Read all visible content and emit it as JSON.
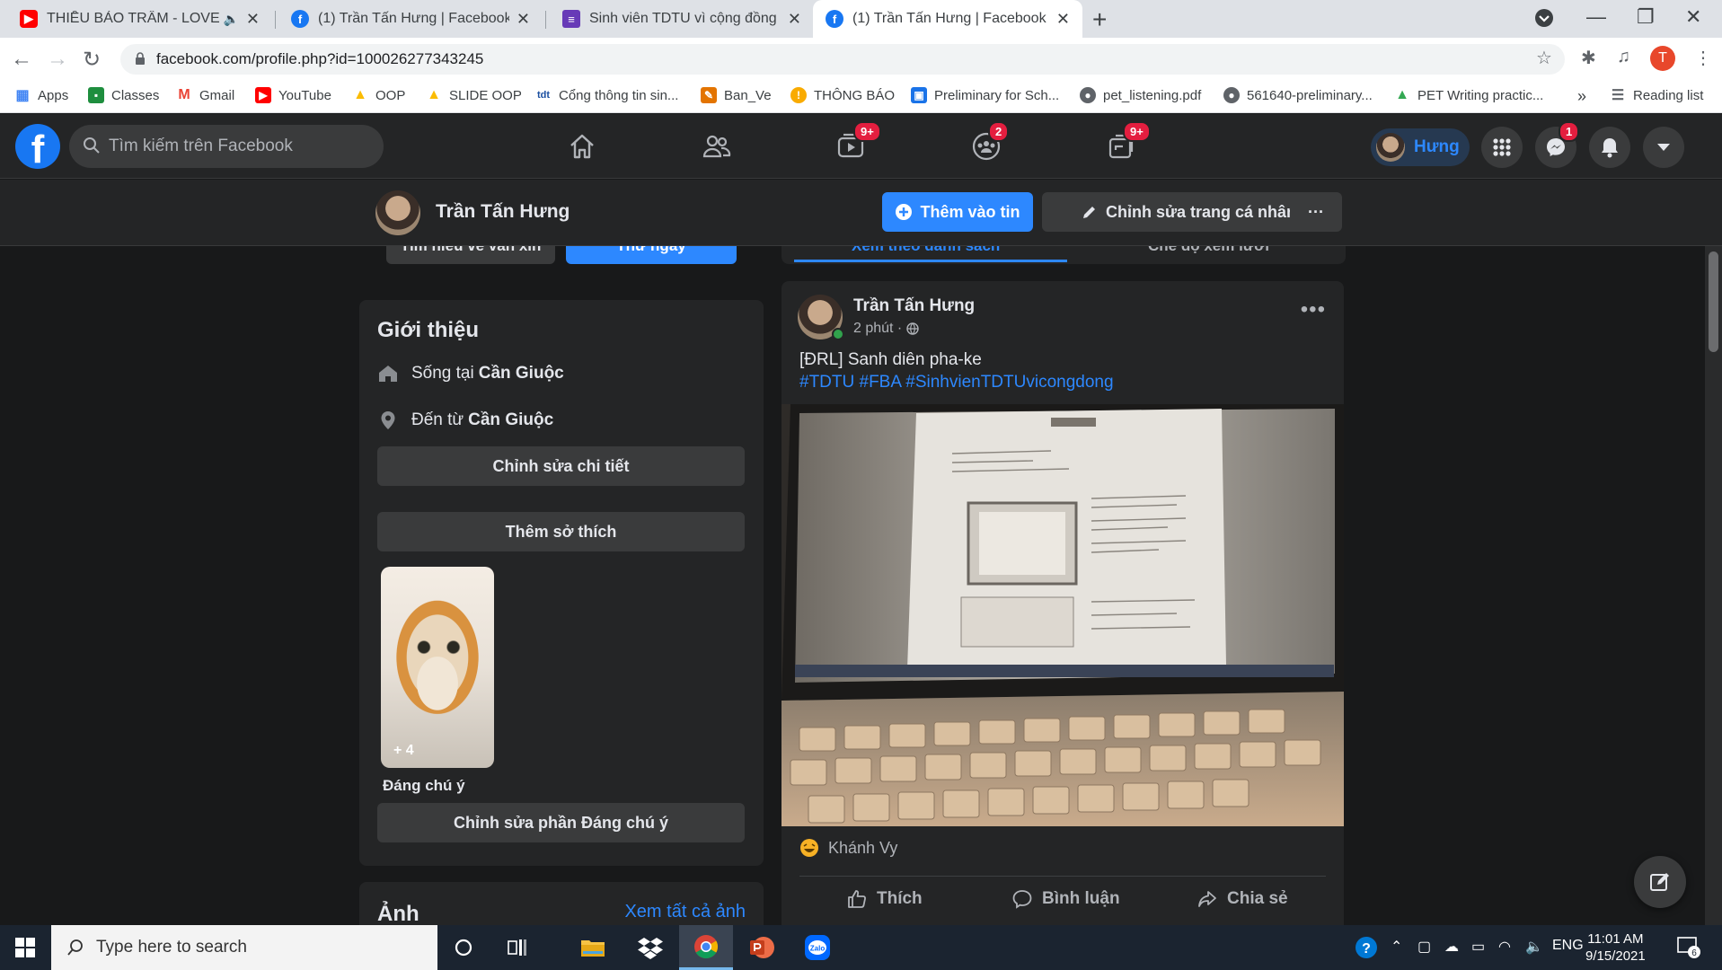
{
  "browser": {
    "tabs": [
      {
        "title": "THIỀU BẢO TRÂM - LOVE RO",
        "icon": "youtube-icon"
      },
      {
        "title": "(1) Trần Tấn Hưng | Facebook",
        "icon": "facebook-icon"
      },
      {
        "title": "Sinh viên TDTU vì cộng đồng",
        "icon": "forms-icon"
      },
      {
        "title": "(1) Trần Tấn Hưng | Facebook",
        "icon": "facebook-icon"
      }
    ],
    "url": "facebook.com/profile.php?id=100026277343245",
    "profile_initial": "T",
    "bookmarks": [
      {
        "label": "Apps"
      },
      {
        "label": "Classes"
      },
      {
        "label": "Gmail"
      },
      {
        "label": "YouTube"
      },
      {
        "label": "OOP"
      },
      {
        "label": "SLIDE OOP"
      },
      {
        "label": "Cổng thông tin sin..."
      },
      {
        "label": "Ban_Ve"
      },
      {
        "label": "THÔNG BÁO"
      },
      {
        "label": "Preliminary for Sch..."
      },
      {
        "label": "pet_listening.pdf"
      },
      {
        "label": "561640-preliminary..."
      },
      {
        "label": "PET Writing practic..."
      }
    ],
    "reading_list": "Reading list",
    "overflow": "»"
  },
  "fb": {
    "search_placeholder": "Tìm kiếm trên Facebook",
    "badges": {
      "watch": "9+",
      "groups": "2",
      "gaming": "9+",
      "messenger": "1"
    },
    "user_short": "Hưng",
    "profile_name": "Trần Tấn Hưng",
    "add_story": "Thêm vào tin",
    "edit_profile": "Chỉnh sửa trang cá nhân",
    "more": "···"
  },
  "intro": {
    "peek_left": "Tìm hiểu về vấn xin",
    "peek_right": "Thử ngay",
    "title": "Giới thiệu",
    "lives_prefix": "Sống tại",
    "lives_place": "Cần Giuộc",
    "from_prefix": "Đến từ",
    "from_place": "Cần Giuộc",
    "edit_details": "Chỉnh sửa chi tiết",
    "add_hobbies": "Thêm sở thích",
    "featured_count": "+ 4",
    "featured_label": "Đáng chú ý",
    "edit_featured": "Chỉnh sửa phần Đáng chú ý",
    "photos_title": "Ảnh",
    "see_all_photos": "Xem tất cả ảnh"
  },
  "post": {
    "tab_left": "Xem theo danh sách",
    "tab_right": "Chế độ xem lưới",
    "author": "Trần Tấn Hưng",
    "time": "2 phút ·",
    "text": "[ĐRL] Sanh diên pha-ke",
    "hashtags": "#TDTU #FBA #SinhvienTDTUvicongdong",
    "reactor": "Khánh Vy",
    "like": "Thích",
    "comment": "Bình luận",
    "share": "Chia sẻ"
  },
  "taskbar": {
    "search_placeholder": "Type here to search",
    "lang": "ENG",
    "time": "11:01 AM",
    "date": "9/15/2021",
    "notifications": "6"
  },
  "colors": {
    "fb_blue": "#2d88ff",
    "fb_dark": "#18191a",
    "card": "#242526"
  }
}
